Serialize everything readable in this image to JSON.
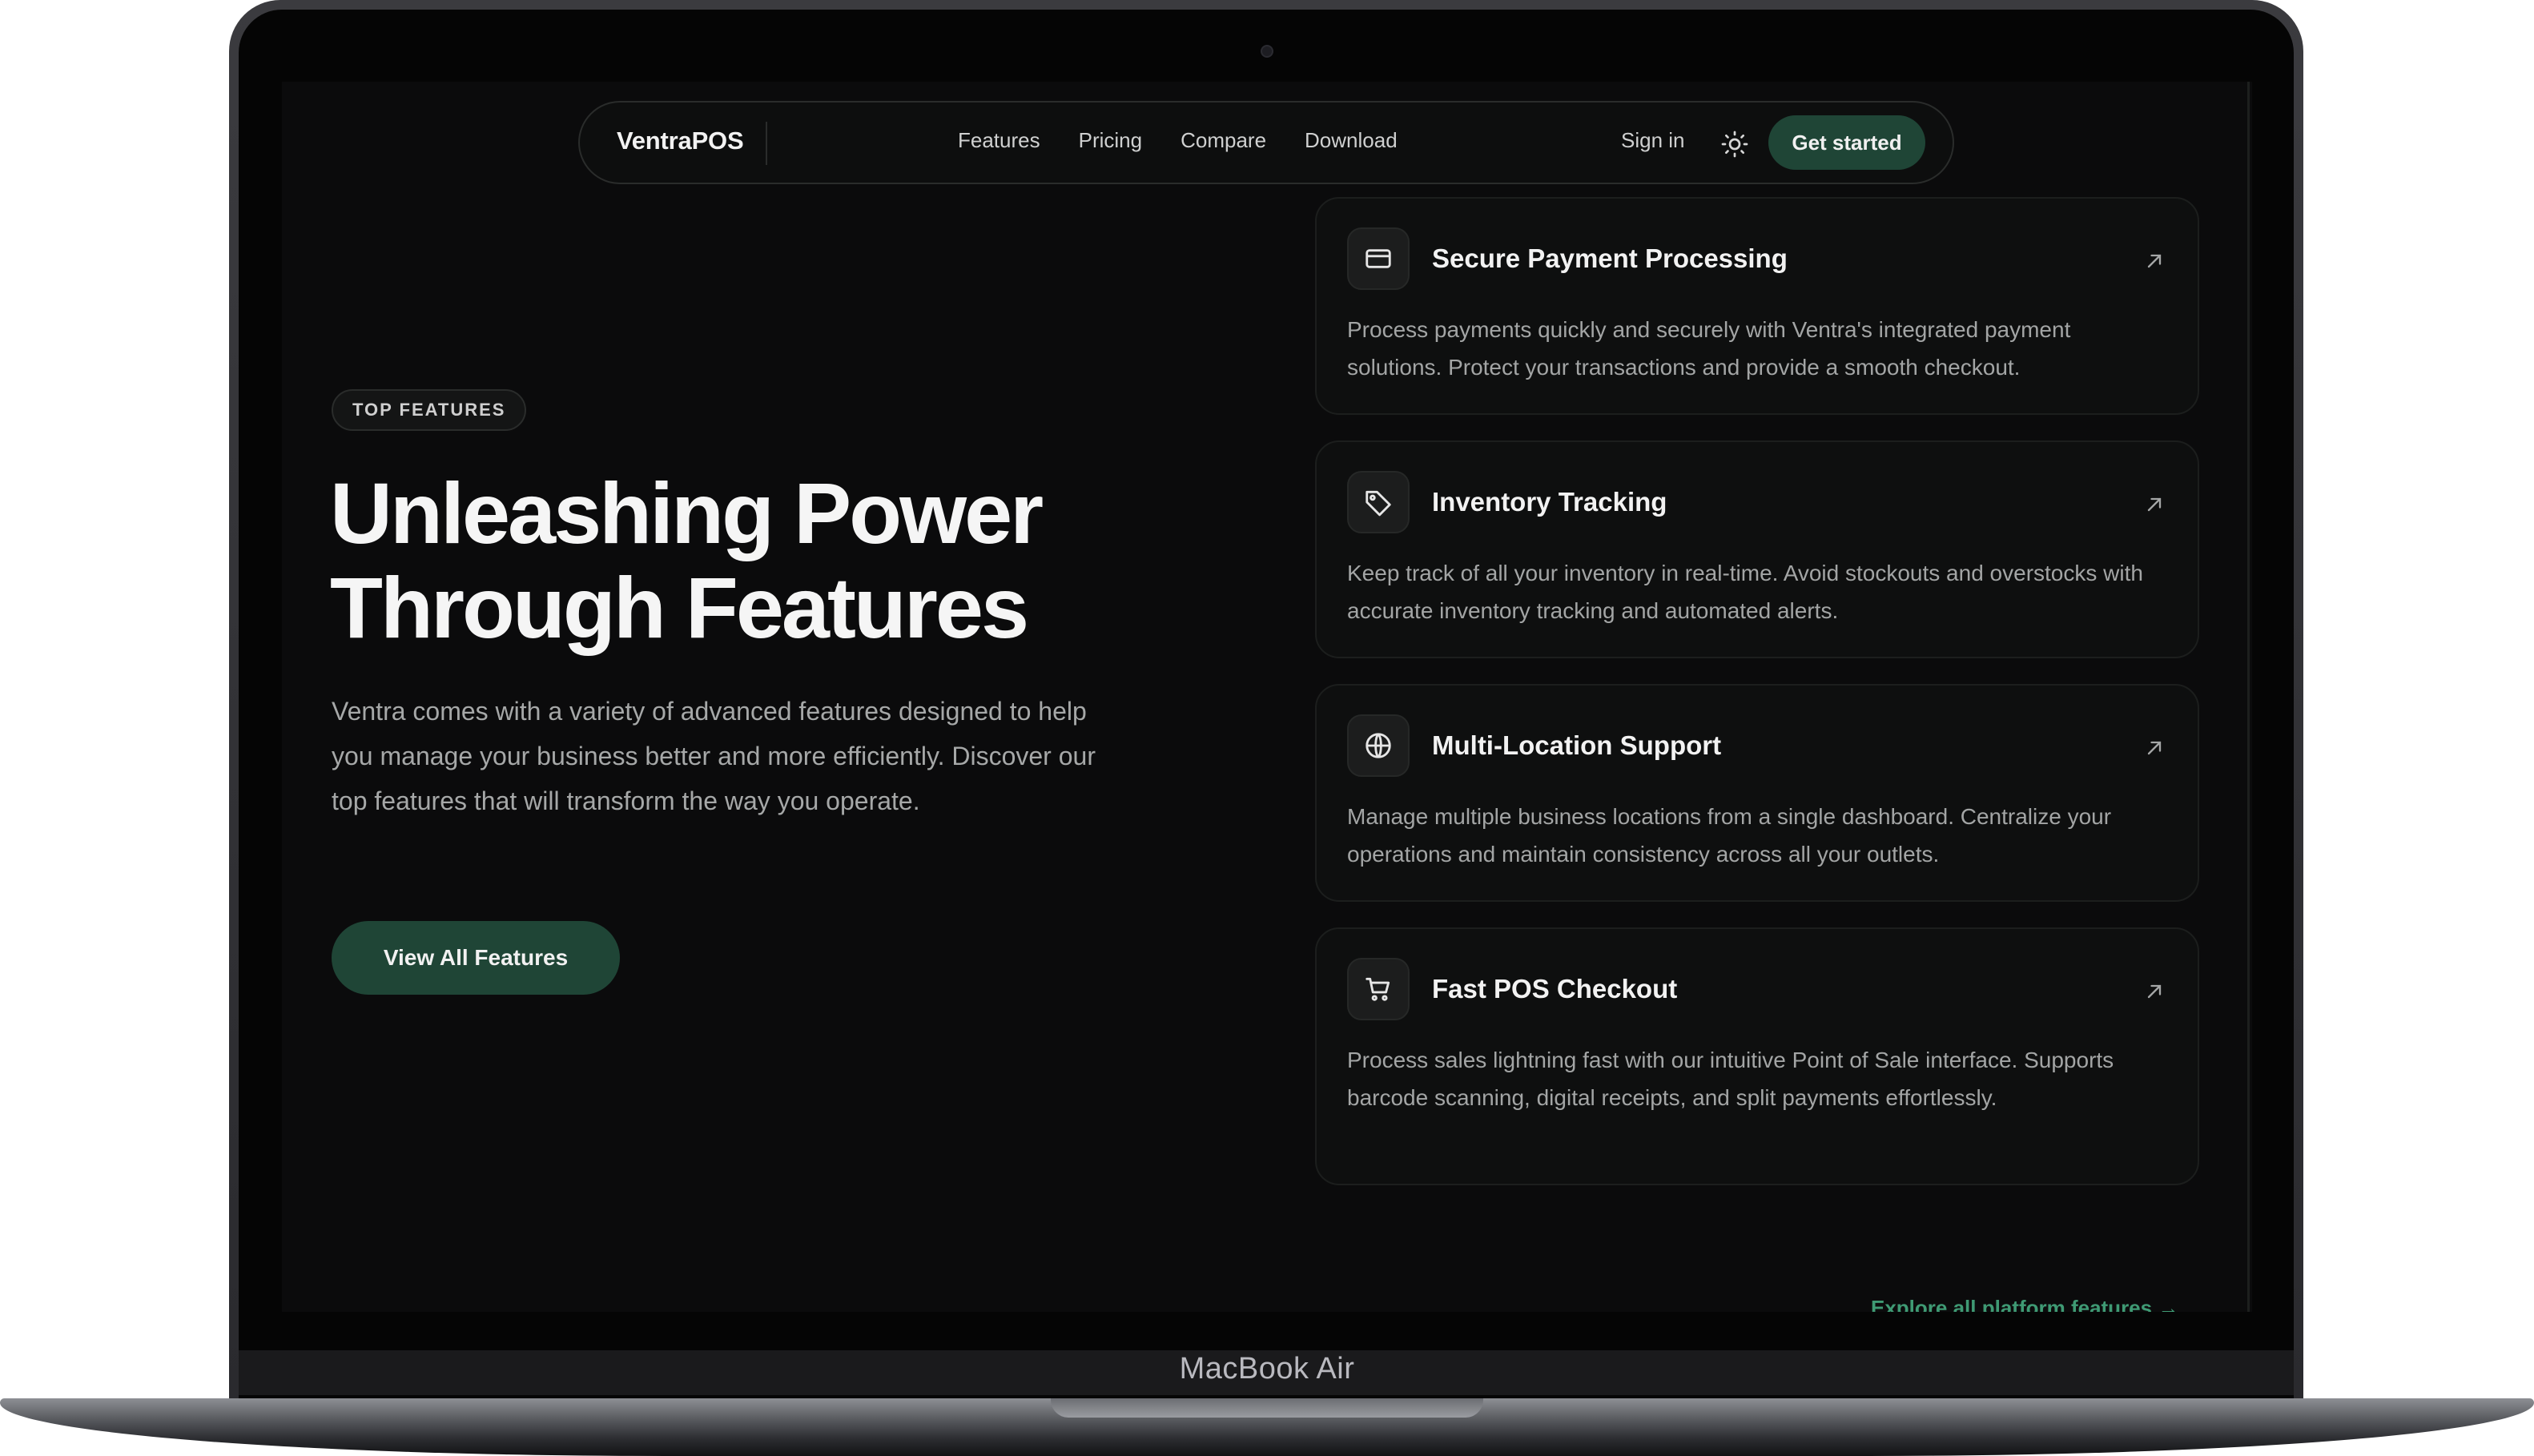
{
  "device": {
    "label": "MacBook Air"
  },
  "nav": {
    "logo": "VentraPOS",
    "links": [
      "Features",
      "Pricing",
      "Compare",
      "Download"
    ],
    "sign_in": "Sign in",
    "theme_icon": "sun-icon",
    "cta": "Get started"
  },
  "hero": {
    "badge": "TOP FEATURES",
    "title_line1": "Unleashing Power",
    "title_line2": "Through Features",
    "description": "Ventra comes with a variety of advanced features designed to help you manage your business better and more efficiently. Discover our top features that will transform the way you operate.",
    "button": "View All Features"
  },
  "features": [
    {
      "icon": "credit-card-icon",
      "title": "Secure Payment Processing",
      "description": "Process payments quickly and securely with Ventra's integrated payment solutions. Protect your transactions and provide a smooth checkout."
    },
    {
      "icon": "tag-icon",
      "title": "Inventory Tracking",
      "description": "Keep track of all your inventory in real-time. Avoid stockouts and overstocks with accurate inventory tracking and automated alerts."
    },
    {
      "icon": "globe-icon",
      "title": "Multi-Location Support",
      "description": "Manage multiple business locations from a single dashboard. Centralize your operations and maintain consistency across all your outlets."
    },
    {
      "icon": "shopping-cart-icon",
      "title": "Fast POS Checkout",
      "description": "Process sales lightning fast with our intuitive Point of Sale interface. Supports barcode scanning, digital receipts, and split payments effortlessly."
    }
  ],
  "explore_link": "Explore all platform features →",
  "colors": {
    "accent": "#1f4536",
    "accent_text": "#3f9a74",
    "background": "#0b0b0c"
  }
}
